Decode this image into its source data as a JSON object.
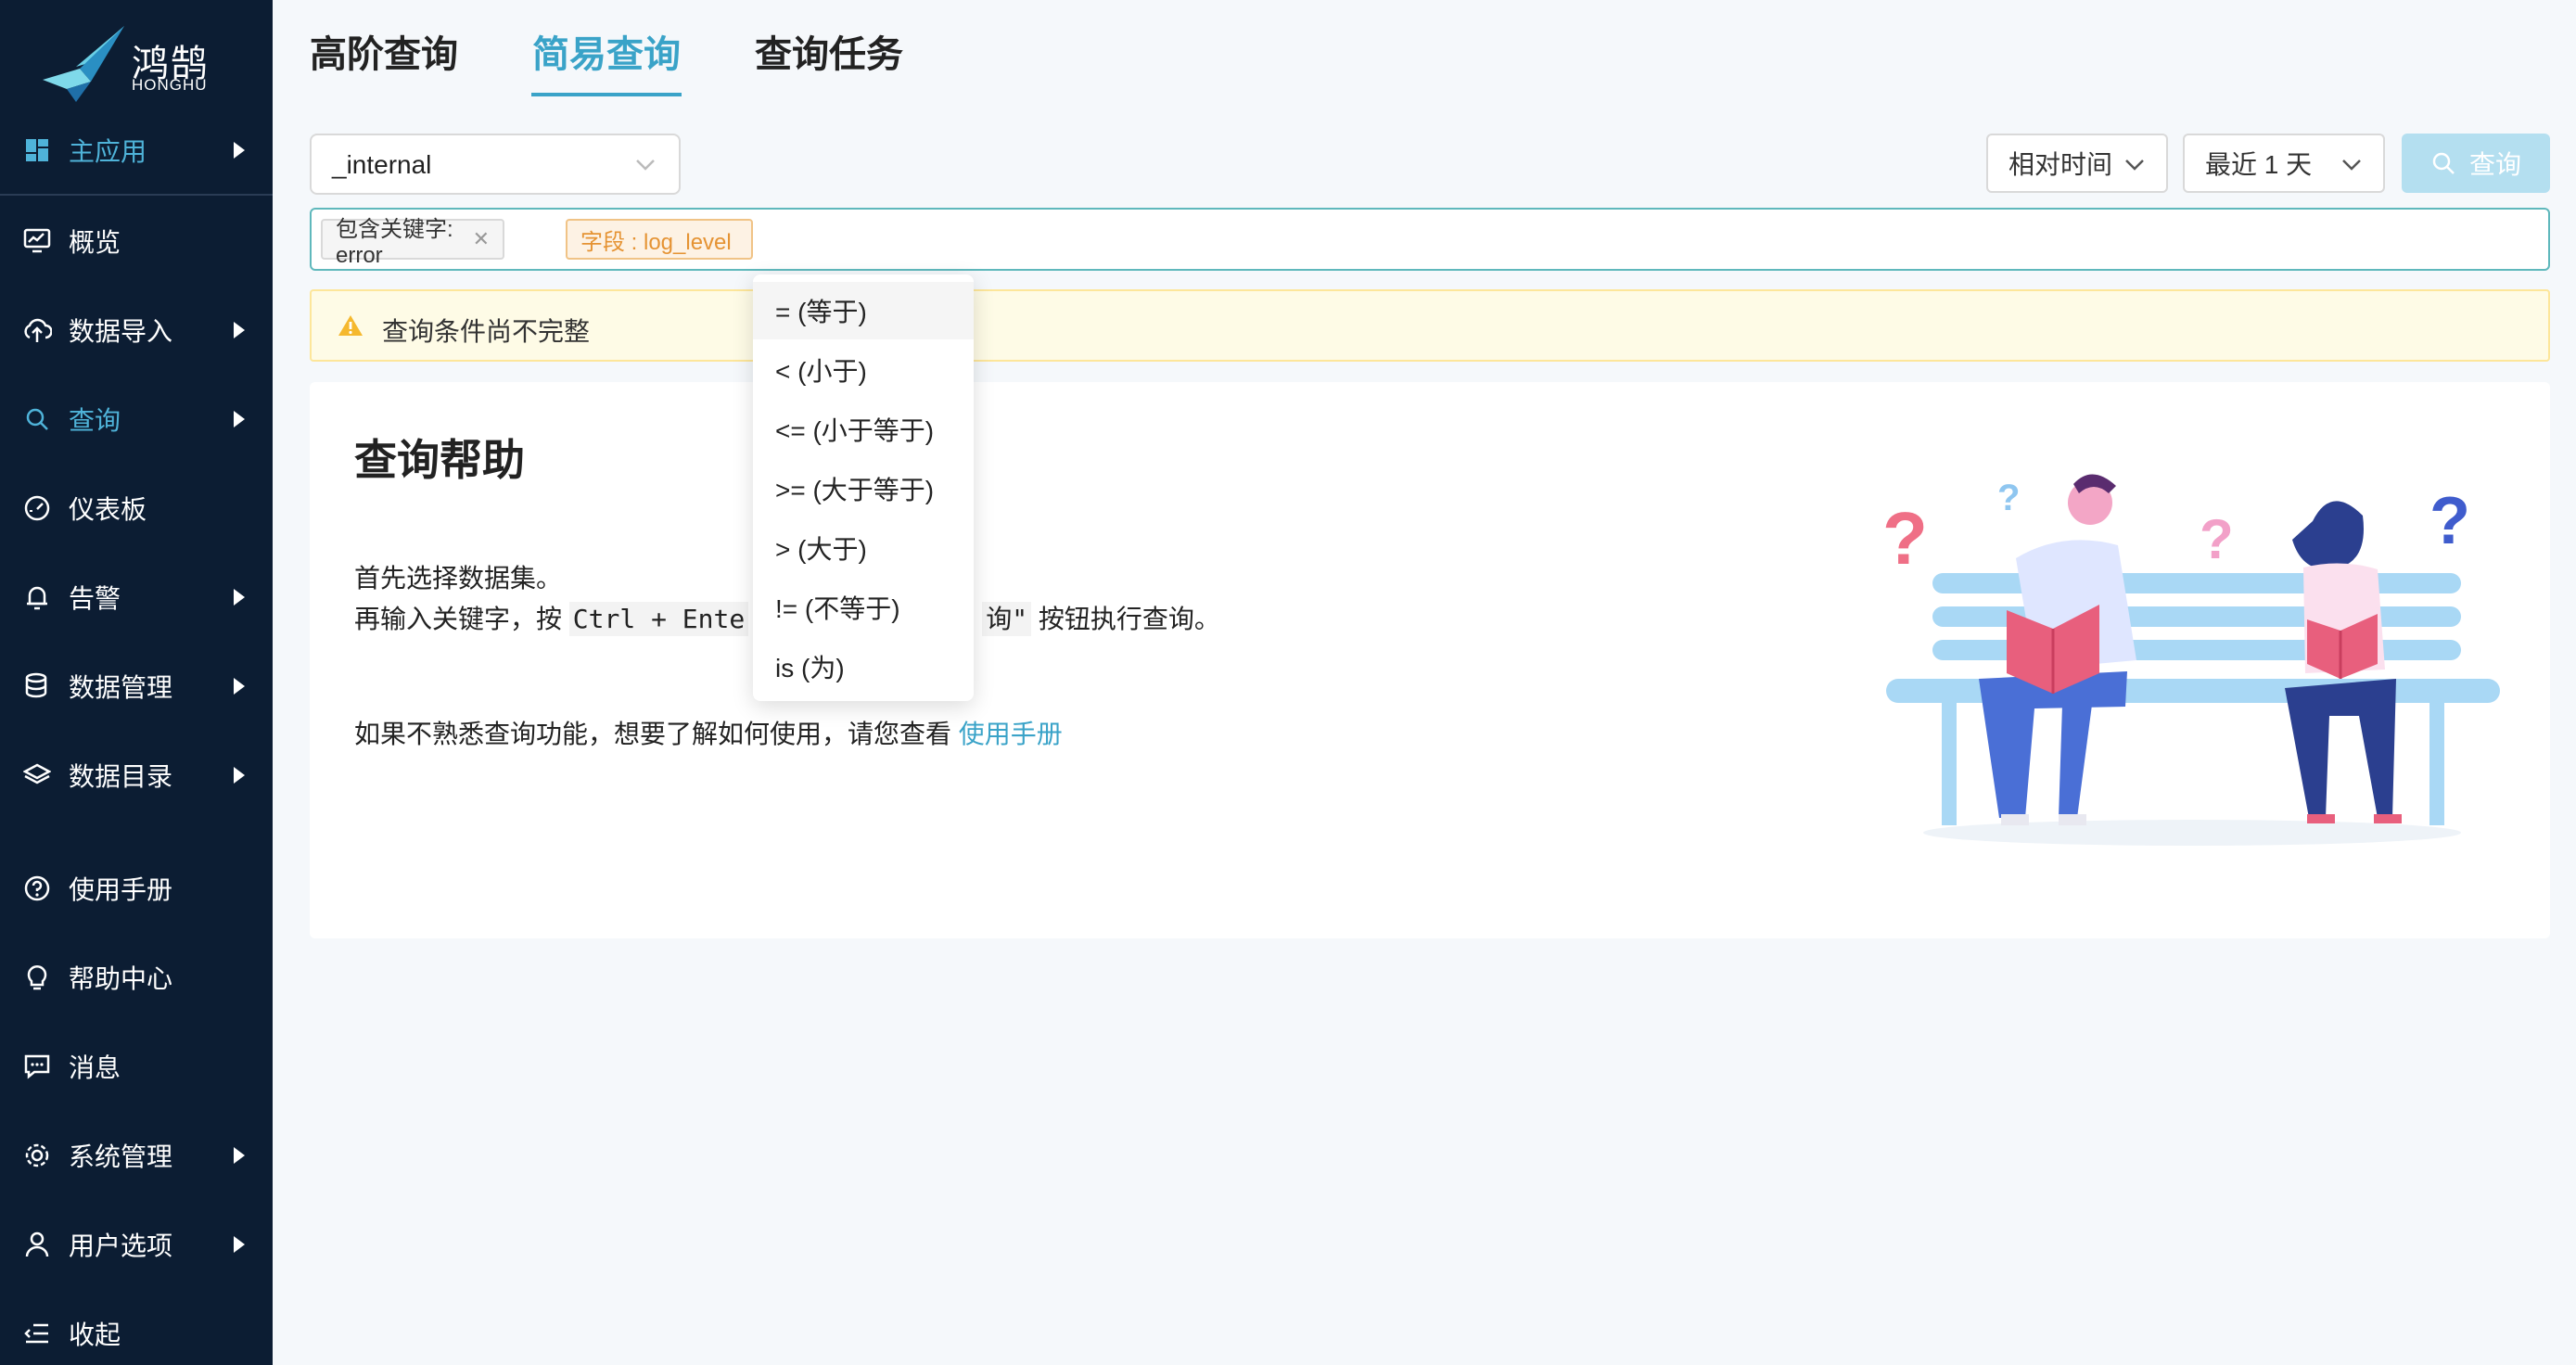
{
  "brand": {
    "name_cn": "鸿鹄",
    "name_en": "HONGHU"
  },
  "sidebar": {
    "items": [
      {
        "label": "主应用",
        "icon": "dashboard-grid-icon",
        "has_arrow": true,
        "active": true
      },
      {
        "label": "概览",
        "icon": "monitor-chart-icon",
        "has_arrow": false
      },
      {
        "label": "数据导入",
        "icon": "cloud-upload-icon",
        "has_arrow": true
      },
      {
        "label": "查询",
        "icon": "search-icon",
        "has_arrow": true,
        "active": true
      },
      {
        "label": "仪表板",
        "icon": "gauge-icon",
        "has_arrow": false
      },
      {
        "label": "告警",
        "icon": "bell-icon",
        "has_arrow": true
      },
      {
        "label": "数据管理",
        "icon": "database-icon",
        "has_arrow": true
      },
      {
        "label": "数据目录",
        "icon": "layers-icon",
        "has_arrow": true
      },
      {
        "label": "使用手册",
        "icon": "question-circle-icon",
        "has_arrow": false
      },
      {
        "label": "帮助中心",
        "icon": "bulb-icon",
        "has_arrow": false
      },
      {
        "label": "消息",
        "icon": "message-icon",
        "has_arrow": false
      },
      {
        "label": "系统管理",
        "icon": "gear-icon",
        "has_arrow": true
      },
      {
        "label": "用户选项",
        "icon": "user-icon",
        "has_arrow": true
      },
      {
        "label": "收起",
        "icon": "menu-fold-icon",
        "has_arrow": false
      }
    ]
  },
  "tabs": [
    {
      "label": "高阶查询",
      "active": false
    },
    {
      "label": "简易查询",
      "active": true
    },
    {
      "label": "查询任务",
      "active": false
    }
  ],
  "toolbar": {
    "dataset_value": "_internal",
    "time_mode": "相对时间",
    "time_range": "最近 1 天",
    "query_label": "查询"
  },
  "filters": {
    "keyword_chip": "包含关键字: error",
    "field_chip": "字段 : log_level"
  },
  "warning": {
    "text": "查询条件尚不完整"
  },
  "help": {
    "title": "查询帮助",
    "line1": "首先选择数据集。",
    "line2_prefix": "再输入关键字，按 ",
    "line2_code": "Ctrl + Ente",
    "line2_code_tail": "询\"",
    "line2_suffix": " 按钮执行查询。",
    "line3_prefix": "如果不熟悉查询功能，想要了解如何使用，请您查看 ",
    "line3_link": "使用手册"
  },
  "operators": [
    "=   (等于)",
    "<   (小于)",
    "<=   (小于等于)",
    ">=   (大于等于)",
    ">   (大于)",
    "!=   (不等于)",
    "is   (为)"
  ],
  "colors": {
    "sidebar_bg": "#0c1d33",
    "accent": "#3aa3c8",
    "warning_bg": "#fefbe6",
    "chip_field": "#e59333"
  }
}
